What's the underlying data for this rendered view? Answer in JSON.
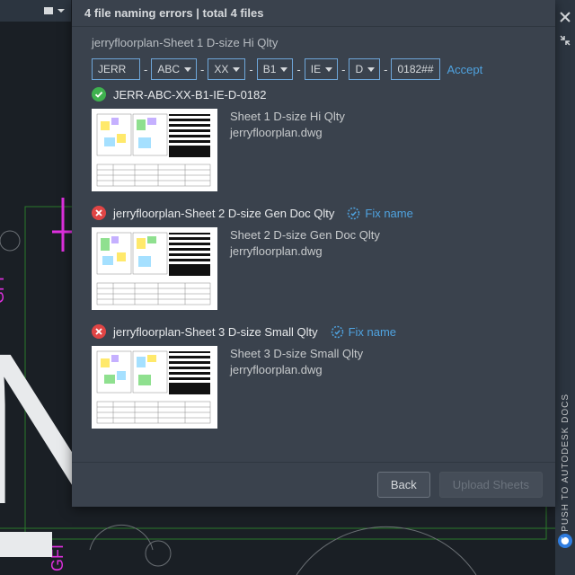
{
  "header": {
    "title": "4 file naming errors | total 4 files"
  },
  "rail": {
    "label": "PUSH TO AUTODESK DOCS"
  },
  "current": {
    "name": "jerryfloorplan-Sheet 1 D-size Hi Qlty",
    "fields": {
      "f1": "JERR",
      "f2": "ABC",
      "f3": "XX",
      "f4": "B1",
      "f5": "IE",
      "f6": "D",
      "f7": "0182##"
    },
    "accept": "Accept",
    "result": "JERR-ABC-XX-B1-IE-D-0182"
  },
  "files": [
    {
      "title": "Sheet 1 D-size Hi Qlty",
      "dwg": "jerryfloorplan.dwg"
    },
    {
      "name": "jerryfloorplan-Sheet 2 D-size Gen Doc Qlty",
      "fix": "Fix name",
      "title": "Sheet 2 D-size Gen Doc Qlty",
      "dwg": "jerryfloorplan.dwg"
    },
    {
      "name": "jerryfloorplan-Sheet 3 D-size Small Qlty",
      "fix": "Fix name",
      "title": "Sheet 3 D-size Small Qlty",
      "dwg": "jerryfloorplan.dwg"
    }
  ],
  "footer": {
    "back": "Back",
    "upload": "Upload Sheets"
  }
}
